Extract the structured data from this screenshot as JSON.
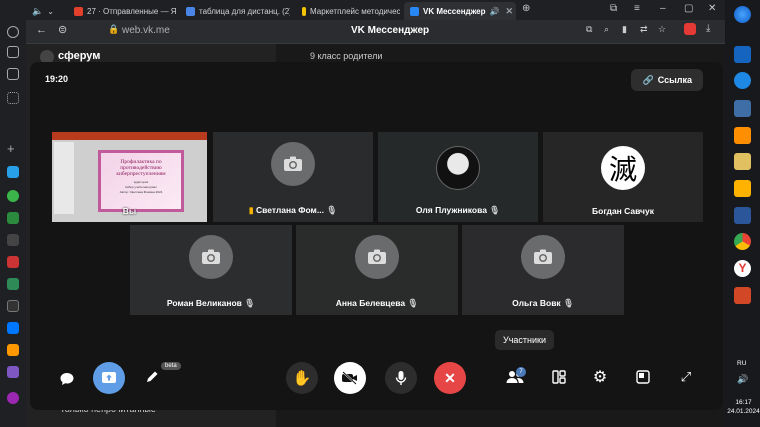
{
  "tabs": [
    {
      "title": "27 · Отправленные — Янд",
      "color": "#e2402b"
    },
    {
      "title": "таблица для дистанц. (2).d",
      "color": "#4a86e8"
    },
    {
      "title": "Маркетплейс методическ",
      "color": "#f5c400"
    },
    {
      "title": "VK Мессенджер",
      "color": "#2787f5"
    }
  ],
  "address": {
    "url": "web.vk.me",
    "page_title": "VK Мессенджер"
  },
  "background": {
    "chat_title": "9 класс родители",
    "brand": "сферум",
    "bottom_text": "Только непрочитанные"
  },
  "call": {
    "time": "19:20",
    "link_label": "Ссылка",
    "tiles_row1": [
      {
        "name": "Вы",
        "type": "screen"
      },
      {
        "name": "Светлана Фом...",
        "type": "camera",
        "speaking": true
      },
      {
        "name": "Оля Плужникова",
        "type": "avatar"
      },
      {
        "name": "Богдан Савчук",
        "type": "glyph",
        "glyph": "滅"
      }
    ],
    "tiles_row2": [
      {
        "name": "Роман Великанов",
        "type": "camera"
      },
      {
        "name": "Анна Белевцева",
        "type": "camera"
      },
      {
        "name": "Ольга Вовк",
        "type": "camera"
      }
    ],
    "slide": {
      "title": "Профилактика по противодействию киберпреступлениям",
      "sub1": "аудитория",
      "sub2": "Кибер учебн материал",
      "sub3": "Автор: Светлана Фомина 2024"
    },
    "tooltip": "Участники",
    "participants_badge": "7",
    "beta_label": "beta"
  },
  "taskbar": {
    "lang": "RU",
    "time": "16:17",
    "date": "24.01.2024",
    "notif": "6"
  }
}
